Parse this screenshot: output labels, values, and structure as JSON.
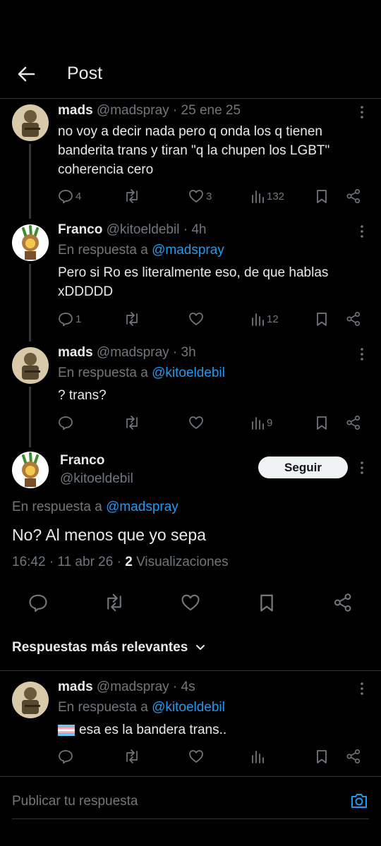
{
  "header": {
    "title": "Post",
    "back_icon": "arrow-left-icon"
  },
  "thread": [
    {
      "name": "mads",
      "handle": "@madspray",
      "time": "· 25 ene 25",
      "reply_to_prefix": "",
      "reply_to": "",
      "text": "no voy a decir nada pero q onda los q tienen banderita trans y tiran \"q la chupen los LGBT\" coherencia cero",
      "replies": "4",
      "reposts": "",
      "likes": "3",
      "views": "132"
    },
    {
      "name": "Franco",
      "handle": "@kitoeldebil",
      "time": "· 4h",
      "reply_to_prefix": "En respuesta a",
      "reply_to": "@madspray",
      "text": "Pero si Ro es literalmente eso, de que hablas xDDDDD",
      "replies": "1",
      "reposts": "",
      "likes": "",
      "views": "12"
    },
    {
      "name": "mads",
      "handle": "@madspray",
      "time": "· 3h",
      "reply_to_prefix": "En respuesta a",
      "reply_to": "@kitoeldebil",
      "text": "? trans?",
      "replies": "",
      "reposts": "",
      "likes": "",
      "views": "9"
    }
  ],
  "main_tweet": {
    "name": "Franco",
    "handle": "@kitoeldebil",
    "follow_label": "Seguir",
    "reply_to_prefix": "En respuesta a",
    "reply_to": "@madspray",
    "text": "No? Al menos que yo sepa",
    "time": "16:42 · 11 abr 26 ·",
    "views_count": "2",
    "views_label": "Visualizaciones"
  },
  "replies_section": {
    "sort_label": "Respuestas más relevantes",
    "replies": [
      {
        "name": "mads",
        "handle": "@madspray",
        "time": "· 4s",
        "reply_to_prefix": "En respuesta a",
        "reply_to": "@kitoeldebil",
        "flag": "🏳️‍⚧️",
        "text": "esa es la bandera trans..",
        "replies": "",
        "reposts": "",
        "likes": "",
        "views": ""
      }
    ]
  },
  "compose": {
    "placeholder": "Publicar tu respuesta",
    "camera_icon": "camera-icon"
  },
  "colors": {
    "background": "#000000",
    "text": "#e7e9ea",
    "muted": "#71767b",
    "link": "#1d9bf0",
    "border": "#2f3336"
  }
}
